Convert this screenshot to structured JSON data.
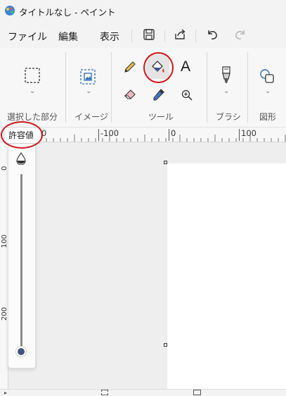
{
  "window": {
    "title": "タイトルなし - ペイント"
  },
  "menu": {
    "file": "ファイル",
    "edit": "編集",
    "view": "表示"
  },
  "toolbar": {
    "save_icon": "save-icon",
    "share_icon": "share-icon",
    "undo_icon": "undo-icon",
    "redo_icon": "redo-icon"
  },
  "ribbon": {
    "groups": [
      {
        "label": "選択した部分",
        "icon": "selection-icon"
      },
      {
        "label": "イメージ",
        "icon": "image-icon"
      },
      {
        "label": "ツール",
        "tools": [
          "pencil-icon",
          "fill-icon",
          "text-icon",
          "eraser-icon",
          "color-picker-icon",
          "magnifier-icon"
        ]
      },
      {
        "label": "ブラシ",
        "icon": "brush-icon"
      },
      {
        "label": "図形",
        "icon": "shapes-icon"
      }
    ],
    "text_tool_glyph": "A",
    "active_tool": "fill"
  },
  "ruler": {
    "labels": [
      "0",
      "-100",
      "0",
      "100"
    ]
  },
  "vertical_ruler": {
    "labels": [
      "0",
      "100",
      "200"
    ]
  },
  "tooltip": {
    "text": "許容値"
  },
  "tolerance": {
    "value_fraction": 1.0
  },
  "colors": {
    "accent": "#42557d",
    "annotation": "#d0161b",
    "selected_tool_bg": "#e4e4e4"
  }
}
